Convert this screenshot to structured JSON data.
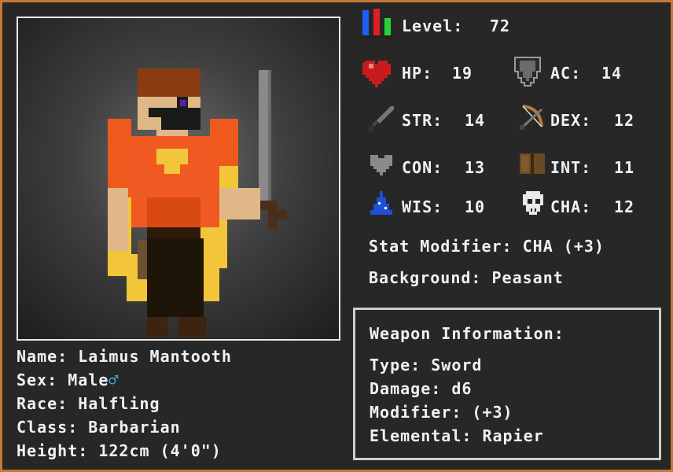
{
  "level": {
    "label": "Level:",
    "value": "72"
  },
  "stats": {
    "hp": {
      "label": "HP:",
      "value": "19"
    },
    "ac": {
      "label": "AC:",
      "value": "14"
    },
    "str": {
      "label": "STR:",
      "value": "14"
    },
    "dex": {
      "label": "DEX:",
      "value": "12"
    },
    "con": {
      "label": "CON:",
      "value": "13"
    },
    "int": {
      "label": "INT:",
      "value": "11"
    },
    "wis": {
      "label": "WIS:",
      "value": "10"
    },
    "cha": {
      "label": "CHA:",
      "value": "12"
    }
  },
  "stat_modifier": "Stat Modifier: CHA (+3)",
  "background": "Background: Peasant",
  "character": {
    "name": "Name: Laimus Mantooth",
    "sex": "Sex: Male",
    "sex_symbol": "♂",
    "race": "Race: Halfling",
    "class": "Class: Barbarian",
    "height": "Height: 122cm (4'0\")"
  },
  "weapon": {
    "title": "Weapon Information:",
    "type": "Type: Sword",
    "damage": "Damage: d6",
    "modifier": "Modifier: (+3)",
    "elemental": "Elemental: Rapier"
  },
  "icons": {
    "level": "level-bars-icon",
    "hp": "heart-icon",
    "ac": "shield-icon",
    "str": "sword-icon",
    "dex": "bow-icon",
    "con": "stone-heart-icon",
    "int": "book-icon",
    "wis": "wizard-hat-icon",
    "cha": "skull-icon"
  },
  "colors": {
    "border": "#c47a34",
    "background": "#272727",
    "text": "#f1f1f1",
    "male_symbol": "#4aa7e6"
  }
}
